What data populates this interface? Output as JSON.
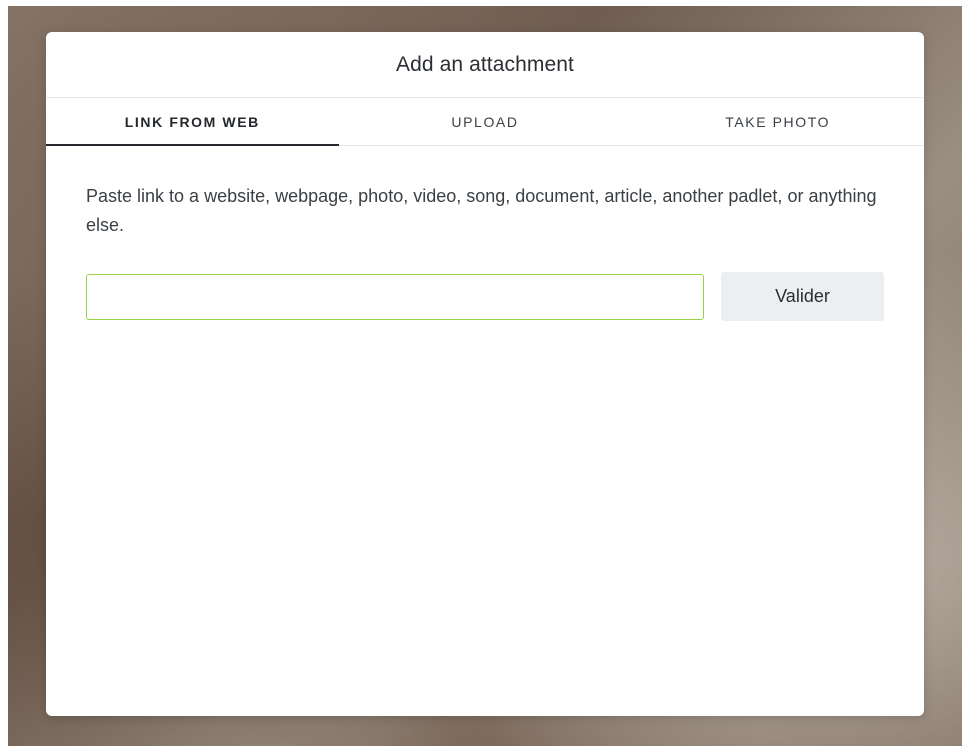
{
  "modal": {
    "title": "Add an attachment",
    "tabs": [
      {
        "label": "LINK FROM WEB",
        "active": true
      },
      {
        "label": "UPLOAD",
        "active": false
      },
      {
        "label": "TAKE PHOTO",
        "active": false
      }
    ],
    "instructions": "Paste link to a website, webpage, photo, video, song, document, article, another padlet, or anything else.",
    "link_input": {
      "value": "",
      "placeholder": ""
    },
    "validate_label": "Valider"
  },
  "colors": {
    "input_focus_border": "#9ad14b",
    "button_background": "#eceff1",
    "active_tab_underline": "#24282c"
  }
}
